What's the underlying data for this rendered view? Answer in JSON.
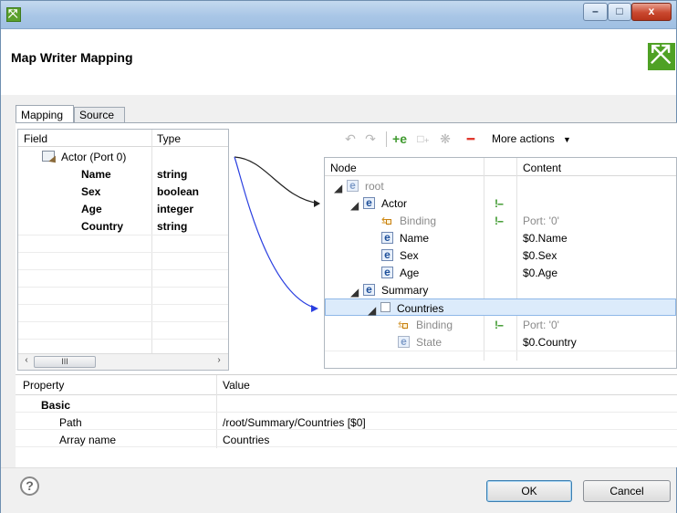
{
  "window": {
    "title": "",
    "controls": {
      "minimize": "–",
      "maximize": "□",
      "close": "x"
    }
  },
  "header": {
    "title": "Map Writer Mapping"
  },
  "tabs": [
    {
      "label": "Mapping",
      "active": true
    },
    {
      "label": "Source",
      "active": false
    }
  ],
  "field_table": {
    "columns": [
      "Field",
      "Type"
    ],
    "port": {
      "label": "Actor (Port 0)"
    },
    "rows": [
      {
        "field": "Name",
        "type": "string"
      },
      {
        "field": "Sex",
        "type": "boolean"
      },
      {
        "field": "Age",
        "type": "integer"
      },
      {
        "field": "Country",
        "type": "string"
      }
    ],
    "scrollbar": {
      "left": "‹",
      "right": "›",
      "thumb": "III"
    }
  },
  "toolbar": {
    "icons": [
      "undo-icon",
      "redo-icon",
      "add-element-icon",
      "add-attribute-icon",
      "add-wildcard-icon",
      "remove-icon"
    ],
    "more_actions": "More actions"
  },
  "tree_table": {
    "columns": [
      "Node",
      "Content"
    ],
    "rows": [
      {
        "label": "root",
        "content": "",
        "kind": "element",
        "disabled": true
      },
      {
        "label": "Actor",
        "content": "",
        "kind": "element",
        "key": true
      },
      {
        "label": "Binding",
        "content": "Port: '0'",
        "kind": "binding",
        "key": true
      },
      {
        "label": "Name",
        "content": "$0.Name",
        "kind": "element"
      },
      {
        "label": "Sex",
        "content": "$0.Sex",
        "kind": "element"
      },
      {
        "label": "Age",
        "content": "$0.Age",
        "kind": "element"
      },
      {
        "label": "Summary",
        "content": "",
        "kind": "element"
      },
      {
        "label": "Countries",
        "content": "",
        "kind": "collection",
        "selected": true
      },
      {
        "label": "Binding",
        "content": "Port: '0'",
        "kind": "binding",
        "key": true
      },
      {
        "label": "State",
        "content": "$0.Country",
        "kind": "element",
        "disabled": true
      }
    ],
    "key_glyph": "!--"
  },
  "properties": {
    "columns": [
      "Property",
      "Value"
    ],
    "group": "Basic",
    "rows": [
      {
        "name": "Path",
        "value": "/root/Summary/Countries [$0]"
      },
      {
        "name": "Array name",
        "value": "Countries"
      }
    ]
  },
  "buttons": {
    "ok": "OK",
    "cancel": "Cancel",
    "help": "?"
  },
  "colors": {
    "mapping_link_black": "#222222",
    "mapping_link_blue": "#2a3fe0",
    "selection": "#dcebfb"
  }
}
